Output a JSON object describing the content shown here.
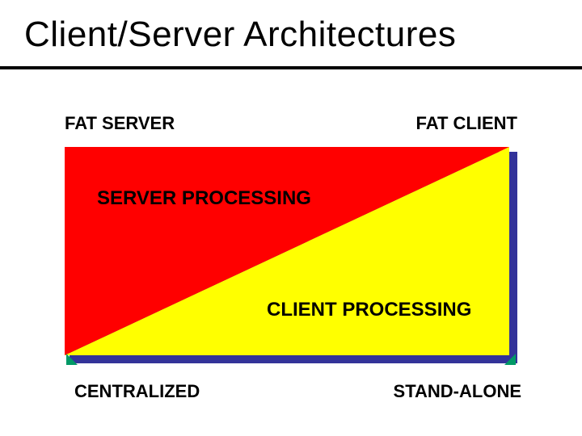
{
  "title": "Client/Server Architectures",
  "labels": {
    "top_left": "FAT SERVER",
    "top_right": "FAT CLIENT",
    "bottom_left": "CENTRALIZED",
    "bottom_right": "STAND-ALONE"
  },
  "regions": {
    "server_label": "SERVER PROCESSING",
    "client_label": "CLIENT PROCESSING"
  },
  "colors": {
    "server_fill": "#ff0000",
    "client_fill": "#ffff00",
    "shadow": "#333399",
    "accent": "#009966"
  }
}
